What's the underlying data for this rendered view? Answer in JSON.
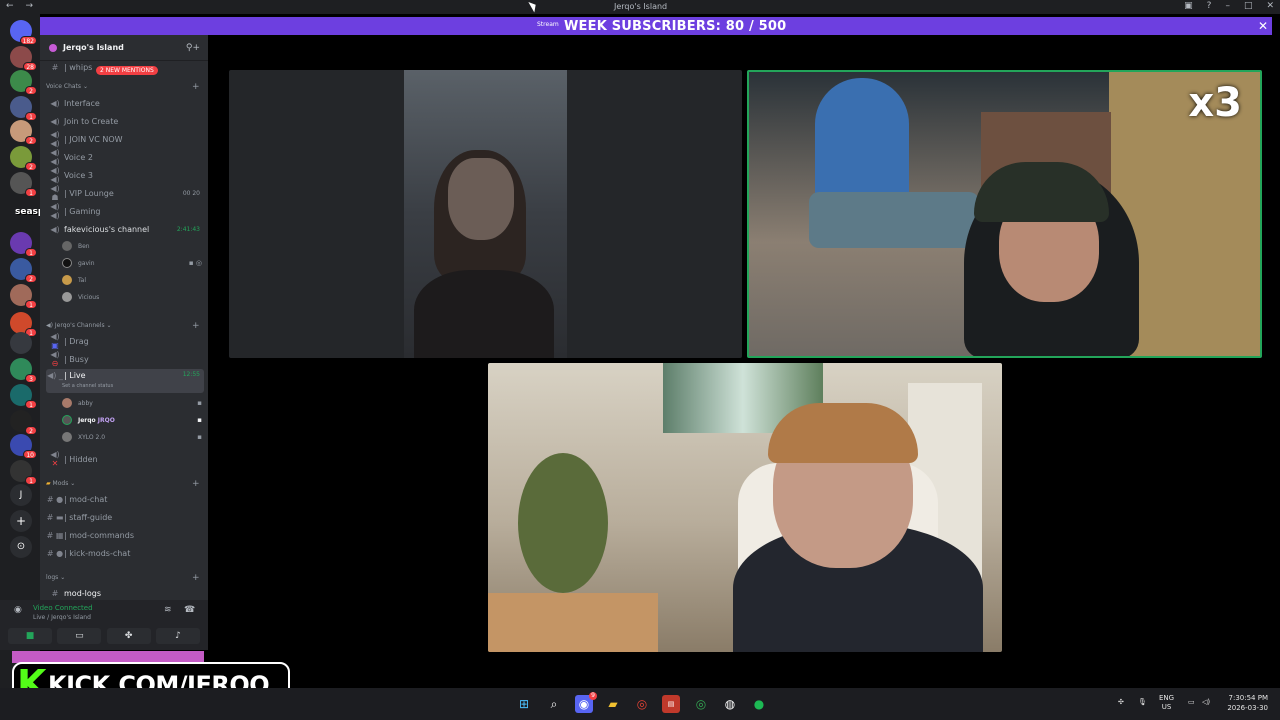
{
  "window": {
    "title": "Jerqo's Island"
  },
  "banner": {
    "overlay": "WEEK SUBSCRIBERS: 80 / 500",
    "under": "Stream",
    "close": "✕"
  },
  "server_badges": [
    "182",
    "28",
    "2",
    "1",
    "2",
    "2",
    "1",
    "1",
    "2",
    "1",
    "1",
    "3",
    "1",
    "2",
    "1",
    "1",
    "1",
    "10",
    "1"
  ],
  "sidebar": {
    "server_name": "Jerqo's Island",
    "mentions": "2 NEW MENTIONS",
    "top_channel": "| whips",
    "voice_category": "Voice Chats",
    "channels": [
      {
        "label": "Interface"
      },
      {
        "label": "Join to Create"
      },
      {
        "label": "| JOIN VC NOW"
      },
      {
        "label": "Voice 2"
      },
      {
        "label": "Voice 3"
      },
      {
        "label": "| VIP Lounge",
        "right": "00  20"
      },
      {
        "label": "| Gaming"
      },
      {
        "label": "fakevicious's channel",
        "right": "2:41:43"
      }
    ],
    "fake_users": [
      "Ben",
      "gavin",
      "Tal",
      "Vicious"
    ],
    "jerqo_category": "Jerqo's Channels",
    "jerqo_channels": [
      {
        "label": "| Drag"
      },
      {
        "label": "| Busy"
      },
      {
        "label": "| Live",
        "right": "12:55",
        "sub": "Set a channel status"
      },
      {
        "label": "| Hidden"
      }
    ],
    "live_users": [
      "abby",
      "Jerqo",
      "XYLO 2.0"
    ],
    "jerqo_tag": "JRQO",
    "mods_category": "Mods",
    "mod_channels": [
      "| mod-chat",
      "| staff-guide",
      "| mod-commands",
      "| kick-mods-chat"
    ],
    "logs_category": "logs",
    "logs_channel": "mod-logs"
  },
  "voice_panel": {
    "status": "Video Connected",
    "channel": "Live / Jerqo's Island"
  },
  "overlay": {
    "seaspark": "seaspark :",
    "kick_k": "K",
    "kick_text": "KICK.COM/JERQO",
    "multiplier": "x3"
  },
  "taskbar": {
    "lang1": "ENG",
    "lang2": "US",
    "time": "7:30:54 PM",
    "date": "2026-03-30",
    "discord_badge": "9"
  },
  "colors": {
    "accent": "#6d3fe0",
    "speaking": "#23a55a",
    "kick": "#53fc18"
  }
}
